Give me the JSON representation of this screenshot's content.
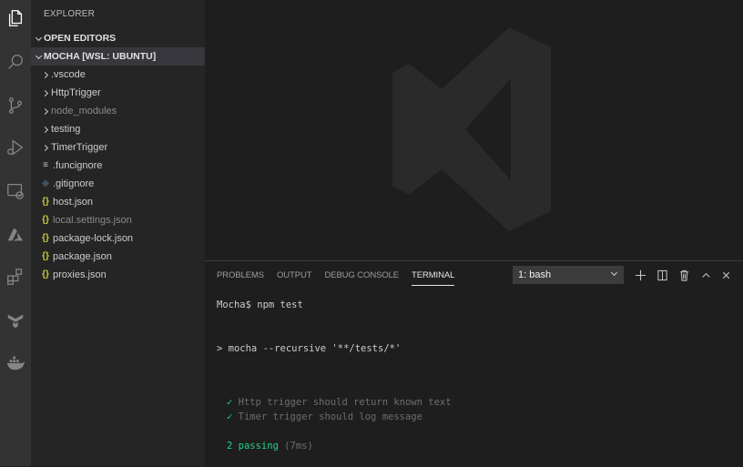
{
  "activity_bar": {
    "icons": [
      "files-icon",
      "search-icon",
      "source-control-icon",
      "run-debug-icon",
      "remote-explorer-icon",
      "azure-icon",
      "extensions-icon",
      "testing-icon",
      "docker-icon"
    ]
  },
  "sidebar": {
    "title": "EXPLORER",
    "open_editors": "OPEN EDITORS",
    "workspace": "MOCHA [WSL: UBUNTU]",
    "items": [
      {
        "label": ".vscode",
        "type": "folder"
      },
      {
        "label": "HttpTrigger",
        "type": "folder"
      },
      {
        "label": "node_modules",
        "type": "folder",
        "dim": true
      },
      {
        "label": "testing",
        "type": "folder"
      },
      {
        "label": "TimerTrigger",
        "type": "folder"
      },
      {
        "label": ".funcignore",
        "type": "file",
        "icon": "≡"
      },
      {
        "label": ".gitignore",
        "type": "file",
        "icon": "◆"
      },
      {
        "label": "host.json",
        "type": "file",
        "icon": "{}"
      },
      {
        "label": "local.settings.json",
        "type": "file",
        "icon": "{}",
        "dim": true
      },
      {
        "label": "package-lock.json",
        "type": "file",
        "icon": "{}"
      },
      {
        "label": "package.json",
        "type": "file",
        "icon": "{}"
      },
      {
        "label": "proxies.json",
        "type": "file",
        "icon": "{}"
      }
    ]
  },
  "panel": {
    "tabs": [
      "PROBLEMS",
      "OUTPUT",
      "DEBUG CONSOLE",
      "TERMINAL"
    ],
    "active_tab": "TERMINAL",
    "terminal_select": "1: bash",
    "actions": [
      "plus-icon",
      "split-icon",
      "trash-icon",
      "chevron-up-icon",
      "close-icon"
    ]
  },
  "terminal": {
    "prompt_line": "Mocha$ npm test",
    "command_line": "> mocha --recursive '**/tests/*'",
    "results": [
      {
        "check": "✓",
        "text": "Http trigger should return known text"
      },
      {
        "check": "✓",
        "text": "Timer trigger should log message"
      }
    ],
    "summary": "2 passing",
    "duration": "(7ms)"
  },
  "colors": {
    "activity_bar": "#333333",
    "sidebar": "#252526",
    "editor": "#1e1e1e",
    "json_icon": "#cbcb41",
    "git_icon": "#41535b",
    "pass_green": "#23d18b"
  }
}
